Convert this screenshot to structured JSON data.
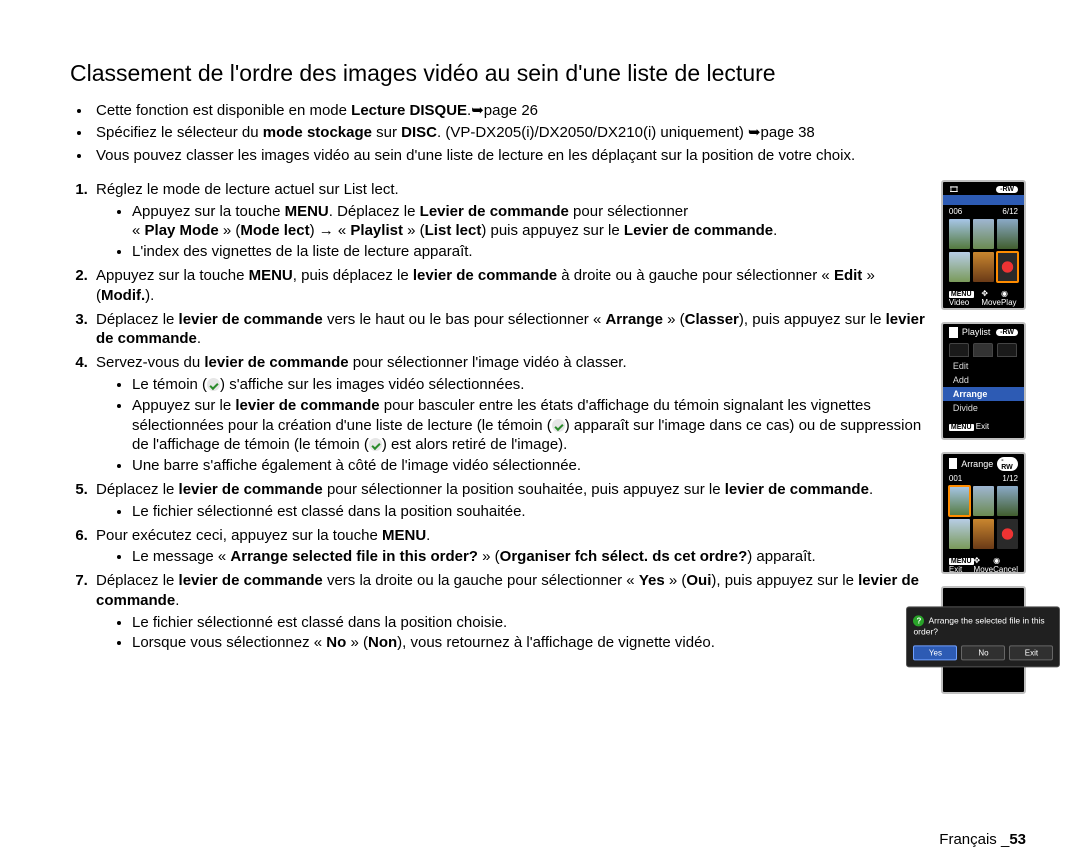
{
  "title": "Classement de l'ordre des images vidéo au sein d'une liste de lecture",
  "intro": [
    {
      "pre": "Cette fonction est disponible en mode ",
      "b": "Lecture DISQUE",
      "post": ".➥page 26"
    },
    {
      "pre": "Spécifiez le sélecteur du ",
      "b": "mode stockage",
      "mid": " sur ",
      "b2": "DISC",
      "post": ". (VP-DX205(i)/DX2050/DX210(i) uniquement) ➥page 38"
    },
    {
      "pre": "Vous pouvez classer les images vidéo au sein d'une liste de lecture en les déplaçant sur la position de votre choix.",
      "b": "",
      "post": ""
    }
  ],
  "step1": {
    "head": "Réglez le mode de lecture actuel sur List lect.",
    "a_pre": "Appuyez sur la touche ",
    "a_b1": "MENU",
    "a_mid": ". Déplacez le ",
    "a_b2": "Levier de commande",
    "a_post": " pour sélectionner",
    "b_pre": "« ",
    "b_b1": "Play Mode",
    "b_m1": " » (",
    "b_b2": "Mode lect",
    "b_m2": ") → « ",
    "b_b3": "Playlist",
    "b_m3": " » (",
    "b_b4": "List lect",
    "b_m4": ") puis appuyez sur le ",
    "b_b5": "Levier de commande",
    "b_post": ".",
    "c": "L'index des vignettes de la liste de lecture apparaît."
  },
  "step2": {
    "pre": "Appuyez sur la touche ",
    "b1": "MENU",
    "m1": ", puis déplacez le ",
    "b2": "levier de commande",
    "m2": " à droite ou à gauche pour sélectionner « ",
    "b3": "Edit",
    "m3": " » (",
    "b4": "Modif.",
    "post": ")."
  },
  "step3": {
    "pre": "Déplacez le ",
    "b1": "levier de commande",
    "m1": " vers le haut ou le bas pour sélectionner « ",
    "b2": "Arrange",
    "m2": " » (",
    "b3": "Classer",
    "m3": "), puis appuyez sur le ",
    "b4": "levier de commande",
    "post": "."
  },
  "step4": {
    "head_pre": "Servez-vous du ",
    "head_b": "levier de commande",
    "head_post": " pour sélectionner l'image vidéo à classer.",
    "a_pre": "Le témoin (",
    "a_post": ") s'affiche sur les images vidéo sélectionnées.",
    "b_pre": "Appuyez sur le ",
    "b_b": "levier de commande",
    "b_mid": " pour basculer entre les états d'affichage du témoin signalant les vignettes sélectionnées pour la création d'une liste de lecture (le témoin (",
    "b_mid2": ") apparaît sur l'image dans ce cas) ou de suppression de l'affichage de témoin (le témoin (",
    "b_post": ") est alors retiré de l'image).",
    "c": "Une barre s'affiche également à côté de l'image vidéo sélectionnée."
  },
  "step5": {
    "pre": "Déplacez le ",
    "b1": "levier de commande",
    "m1": " pour sélectionner la position souhaitée, puis appuyez sur le ",
    "b2": "levier de commande",
    "post": ".",
    "sub": "Le fichier sélectionné est classé dans la position souhaitée."
  },
  "step6": {
    "pre": "Pour exécutez ceci, appuyez sur la touche ",
    "b1": "MENU",
    "post": ".",
    "sub_pre": "Le message « ",
    "sub_b1": "Arrange selected file in this order?",
    "sub_m": " » (",
    "sub_b2": "Organiser fch sélect. ds cet ordre?",
    "sub_post": ") apparaît."
  },
  "step7": {
    "pre": "Déplacez le ",
    "b1": "levier de commande",
    "m1": " vers la droite ou la gauche pour sélectionner « ",
    "b2": "Yes",
    "m2": " » (",
    "b3": "Oui",
    "m3": "), puis appuyez sur le ",
    "b4": "levier de commande",
    "post": ".",
    "sub1": "Le fichier sélectionné est classé dans la position choisie.",
    "sub2_pre": "Lorsque vous sélectionnez « ",
    "sub2_b1": "No",
    "sub2_m": " » (",
    "sub2_b2": "Non",
    "sub2_post": "), vous retournez à l'affichage de vignette vidéo."
  },
  "lcd1": {
    "badge": "-RW",
    "l": "006",
    "r": "6/12",
    "menu": "MENU",
    "b1": "Video",
    "b2": "Move",
    "b3": "Play"
  },
  "lcd2": {
    "title": "Playlist",
    "badge": "-RW",
    "items": [
      "Edit",
      "Add",
      "Arrange",
      "Divide"
    ],
    "hl": 2,
    "menu": "MENU",
    "exit": "Exit"
  },
  "lcd3": {
    "title": "Arrange",
    "badge": "-RW",
    "l": "001",
    "r": "1/12",
    "menu": "MENU",
    "b1": "Exit",
    "b2": "Move",
    "b3": "Cancel"
  },
  "lcd4": {
    "q": "Arrange the selected file in this order?",
    "yes": "Yes",
    "no": "No",
    "exit": "Exit"
  },
  "footer": {
    "lang": "Français _",
    "page": "53"
  }
}
